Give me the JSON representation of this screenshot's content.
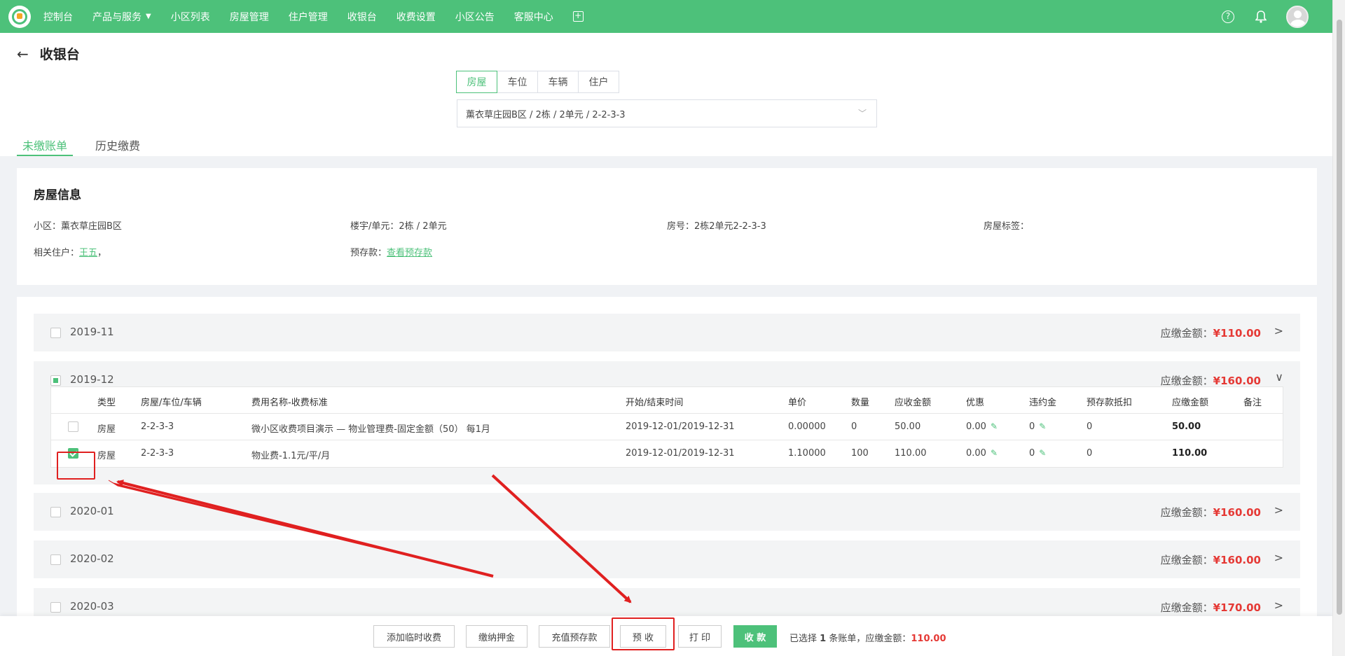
{
  "nav": {
    "items": [
      "控制台",
      "产品与服务",
      "小区列表",
      "房屋管理",
      "住户管理",
      "收银台",
      "收费设置",
      "小区公告",
      "客服中心"
    ],
    "right_icons": [
      "help-icon",
      "bell-icon",
      "avatar"
    ]
  },
  "page": {
    "title": "收银台",
    "segments": [
      "房屋",
      "车位",
      "车辆",
      "住户"
    ],
    "active_segment": "房屋",
    "selector_value": "薰衣草庄园B区 / 2栋 / 2单元 / 2-2-3-3",
    "tabs": [
      "未缴账单",
      "历史缴费"
    ],
    "active_tab": "未缴账单"
  },
  "house_info": {
    "title": "房屋信息",
    "community_label": "小区：",
    "community_value": "薰衣草庄园B区",
    "building_label": "楼宇/单元：",
    "building_value": "2栋 / 2单元",
    "room_label": "房号：",
    "room_value": "2栋2单元2-2-3-3",
    "tag_label": "房屋标签：",
    "tag_value": "",
    "residents_label": "相关住户：",
    "residents_link": "王五",
    "residents_suffix": "，",
    "deposit_label": "预存款：",
    "deposit_link": "查看预存款"
  },
  "bills": {
    "amount_prefix": "应缴金额：",
    "months": [
      {
        "month": "2019-11",
        "amount": "¥110.00",
        "checked": "none",
        "expanded": false
      },
      {
        "month": "2019-12",
        "amount": "¥160.00",
        "checked": "partial",
        "expanded": true
      },
      {
        "month": "2020-01",
        "amount": "¥160.00",
        "checked": "none",
        "expanded": false
      },
      {
        "month": "2020-02",
        "amount": "¥160.00",
        "checked": "none",
        "expanded": false
      },
      {
        "month": "2020-03",
        "amount": "¥170.00",
        "checked": "none",
        "expanded": false
      }
    ],
    "columns": [
      "类型",
      "房屋/车位/车辆",
      "费用名称-收费标准",
      "开始/结束时间",
      "单价",
      "数量",
      "应收金额",
      "优惠",
      "违约金",
      "预存款抵扣",
      "应缴金额",
      "备注"
    ],
    "rows": [
      {
        "type": "房屋",
        "unit": "2-2-3-3",
        "fee": "微小区收费项目演示 — 物业管理费-固定金额（50） 每1月",
        "period": "2019-12-01/2019-12-31",
        "price": "0.00000",
        "qty": "0",
        "receivable": "50.00",
        "discount": "0.00",
        "penalty": "0",
        "deduct": "0",
        "payable": "50.00",
        "note": "",
        "checked": false
      },
      {
        "type": "房屋",
        "unit": "2-2-3-3",
        "fee": "物业费-1.1元/平/月",
        "period": "2019-12-01/2019-12-31",
        "price": "1.10000",
        "qty": "100",
        "receivable": "110.00",
        "discount": "0.00",
        "penalty": "0",
        "deduct": "0",
        "payable": "110.00",
        "note": "",
        "checked": true
      }
    ]
  },
  "bottom": {
    "buttons": [
      "添加临时收费",
      "缴纳押金",
      "充值预存款",
      "预 收",
      "打 印",
      "收 款"
    ],
    "summary_prefix": "已选择",
    "selected_count": "1",
    "summary_mid": "条账单，应缴金额：",
    "summary_amount": "110.00"
  },
  "colors": {
    "brand_green": "#4dc17a",
    "amount_red": "#e53935",
    "annotation_red": "#e02020"
  }
}
